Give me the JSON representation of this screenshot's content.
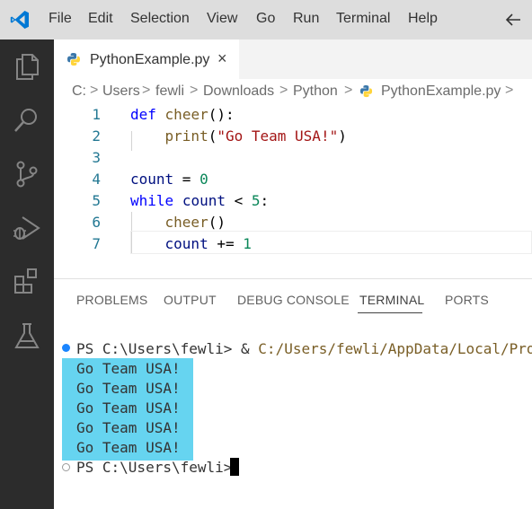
{
  "menu": {
    "items": [
      "File",
      "Edit",
      "Selection",
      "View",
      "Go",
      "Run",
      "Terminal",
      "Help"
    ]
  },
  "icons": {
    "logo": "vscode-logo-icon",
    "back": "arrow-left-icon",
    "activity": [
      "files-explorer-icon",
      "search-icon",
      "source-control-icon",
      "run-debug-icon",
      "extensions-icon",
      "testing-flask-icon"
    ],
    "python": "python-file-icon"
  },
  "tab": {
    "label": "PythonExample.py",
    "close": "×"
  },
  "breadcrumb": {
    "parts": [
      "C:",
      "Users",
      "fewli",
      "Downloads",
      "Python",
      "PythonExample.py"
    ],
    "separator": ">"
  },
  "editor": {
    "lines": [
      {
        "num": "1",
        "code": "def cheer():"
      },
      {
        "num": "2",
        "code": "    print(\"Go Team USA!\")"
      },
      {
        "num": "3",
        "code": ""
      },
      {
        "num": "4",
        "code": "count = 0"
      },
      {
        "num": "5",
        "code": "while count < 5:"
      },
      {
        "num": "6",
        "code": "    cheer()"
      },
      {
        "num": "7",
        "code": "    count += 1"
      }
    ]
  },
  "panel": {
    "tabs": [
      "PROBLEMS",
      "OUTPUT",
      "DEBUG CONSOLE",
      "TERMINAL",
      "PORTS"
    ],
    "active_tab": "TERMINAL"
  },
  "terminal": {
    "prompt": "PS C:\\Users\\fewli>",
    "command_prefix": " & ",
    "command_path": "C:/Users/fewli/AppData/Local/Programs",
    "output": [
      "Go Team USA!",
      "Go Team USA!",
      "Go Team USA!",
      "Go Team USA!",
      "Go Team USA!"
    ]
  },
  "colors": {
    "activitybar": "#2c2c2c",
    "menubar": "#dddddd",
    "highlight": "#66d4f0",
    "status_dot": "#1a85ff"
  }
}
